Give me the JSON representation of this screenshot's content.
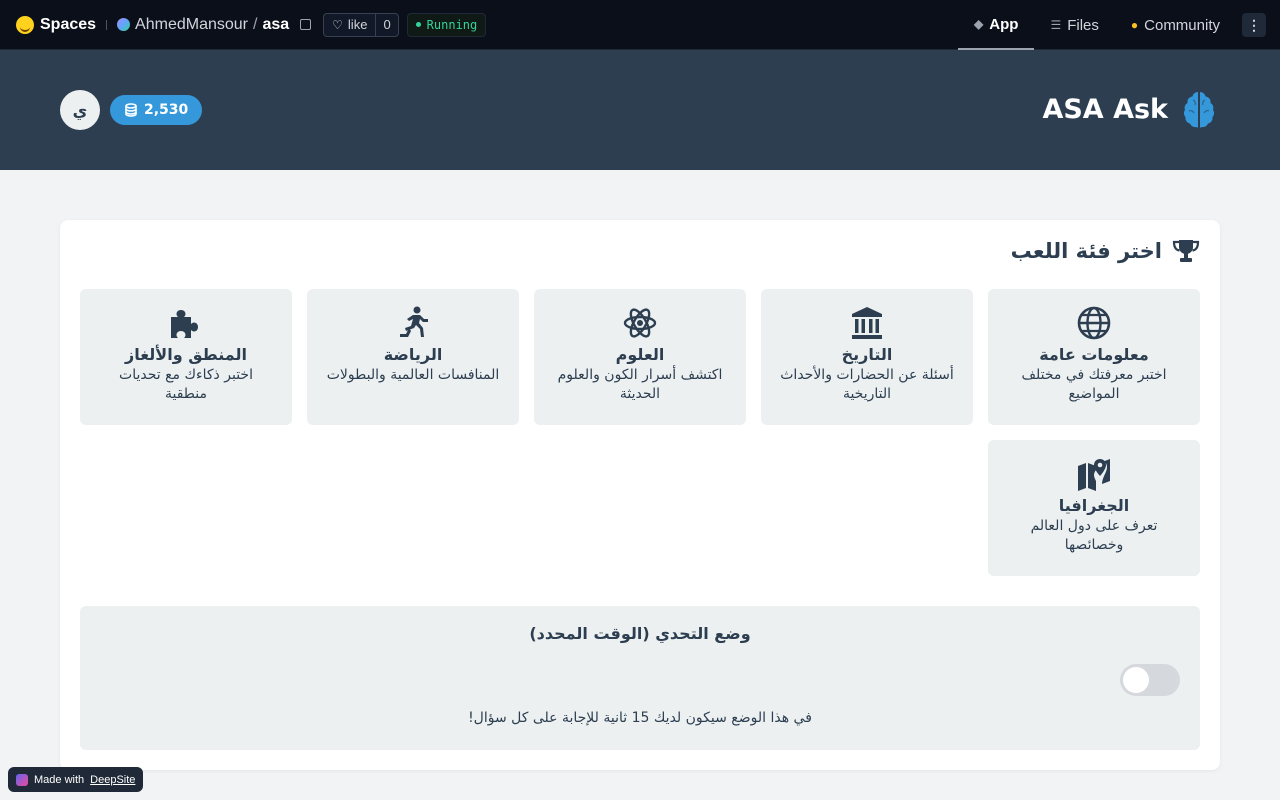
{
  "hf_bar": {
    "spaces_label": "Spaces",
    "owner": "AhmedMansour",
    "slash": "/",
    "repo": "asa",
    "like_label": "like",
    "like_count": "0",
    "status": "Running",
    "nav": {
      "app": "App",
      "files": "Files",
      "community": "Community"
    },
    "menu": "⋮"
  },
  "header": {
    "title": "ASA Ask",
    "avatar_initial": "ي",
    "coins": "2,530",
    "colors": {
      "bg": "#2c3e50",
      "accent": "#3498db"
    }
  },
  "categories_section": {
    "title": "اختر فئة اللعب",
    "items": [
      {
        "icon": "globe-icon",
        "name": "معلومات عامة",
        "desc": "اختبر معرفتك في مختلف المواضيع"
      },
      {
        "icon": "landmark-icon",
        "name": "التاريخ",
        "desc": "أسئلة عن الحضارات والأحداث التاريخية"
      },
      {
        "icon": "atom-icon",
        "name": "العلوم",
        "desc": "اكتشف أسرار الكون والعلوم الحديثة"
      },
      {
        "icon": "running-icon",
        "name": "الرياضة",
        "desc": "المنافسات العالمية والبطولات"
      },
      {
        "icon": "puzzle-icon",
        "name": "المنطق والألغاز",
        "desc": "اختبر ذكاءك مع تحديات منطقية"
      },
      {
        "icon": "map-pin-icon",
        "name": "الجغرافيا",
        "desc": "تعرف على دول العالم وخصائصها"
      }
    ]
  },
  "challenge": {
    "title": "وضع التحدي (الوقت المحدد)",
    "enabled": false,
    "desc": "في هذا الوضع سيكون لديك 15 ثانية للإجابة على كل سؤال!"
  },
  "badge": {
    "prefix": "Made with",
    "link": "DeepSite"
  }
}
